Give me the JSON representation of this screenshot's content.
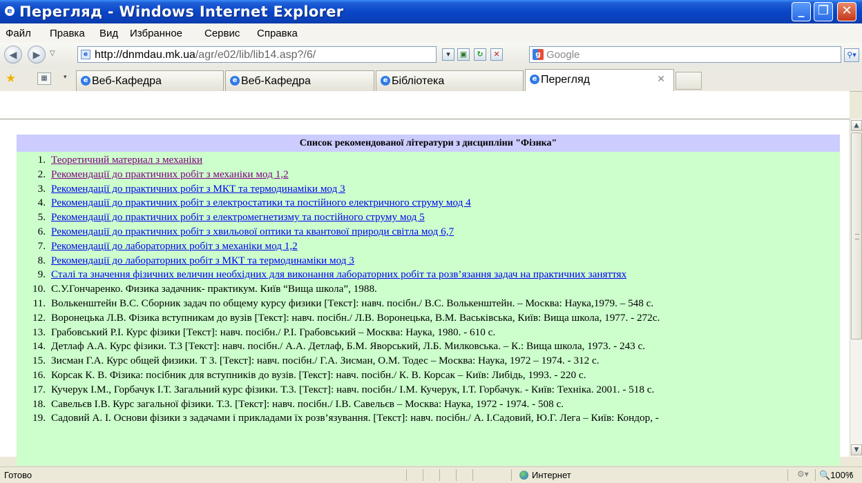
{
  "window": {
    "title": "Перегляд - Windows Internet Explorer",
    "min_glyph": "_",
    "max_glyph": "❐",
    "close_glyph": "✕"
  },
  "menu": {
    "items": [
      "Файл",
      "Правка",
      "Вид",
      "Избранное",
      "Сервис",
      "Справка"
    ]
  },
  "address": {
    "url_host": "http://dnmdau.mk.ua",
    "url_path": "/agr/e02/lib/lib14.asp?/6/",
    "back_glyph": "◀",
    "forward_glyph": "▶",
    "search_placeholder": "Google",
    "search_logo": "g"
  },
  "tabs": [
    {
      "label": "Веб-Кафедра"
    },
    {
      "label": "Веб-Кафедра"
    },
    {
      "label": "Бібліотека"
    },
    {
      "label": "Перегляд",
      "active": true
    }
  ],
  "content": {
    "heading": "Список рекомендованої літератури з дисципліни \"Фізика\"",
    "items": [
      {
        "n": "1.",
        "text": "Теоретичний материал з механіки",
        "link": true,
        "visited": true
      },
      {
        "n": "2.",
        "text": "Рекомендації до практичних робіт з механіки мод 1,2",
        "link": true,
        "visited": true
      },
      {
        "n": "3.",
        "text": "Рекомендації до практичних робіт з МКТ та термодинаміки мод 3",
        "link": true
      },
      {
        "n": "4.",
        "text": "Рекомендації до практичних робіт з електростатики та постійного електричного струму мод 4",
        "link": true
      },
      {
        "n": "5.",
        "text": "Рекомендації до практичних робіт з електромегнетизму та постійного струму мод 5",
        "link": true
      },
      {
        "n": "6.",
        "text": "Рекомендації до практичних робіт з хвильової оптики та квантової природи світла мод 6,7",
        "link": true
      },
      {
        "n": "7.",
        "text": "Рекомендації до лабораторних робіт з механіки мод 1,2",
        "link": true
      },
      {
        "n": "8.",
        "text": "Рекомендації до лабораторних робіт з МКТ та термодинаміки мод 3",
        "link": true
      },
      {
        "n": "9.",
        "text": "Сталі та значення фізичних величин необхідних для виконання лабораторних робіт та розв’язання задач на практичних заняттях",
        "link": true
      },
      {
        "n": "10.",
        "text": "С.У.Гончаренко. Физика задачник- практикум. Київ “Вища школа”, 1988.",
        "link": false
      },
      {
        "n": "11.",
        "text": "Волькенштейн В.С. Сборник задач по общему курсу физики [Текст]: навч. посібн./ В.С. Волькенштейн. – Москва: Наука,1979. – 548 с.",
        "link": false
      },
      {
        "n": "12.",
        "text": "Воронецька Л.В. Фізика вступникам до вузів [Текст]: навч. посібн./ Л.В. Воронецька, В.М. Васьківська, Київ: Вища школа, 1977. - 272с.",
        "link": false
      },
      {
        "n": "13.",
        "text": "Грабовський Р.І. Курс фізики [Текст]: навч. посібн./ Р.І. Грабовський – Москва: Наука, 1980. - 610 с.",
        "link": false
      },
      {
        "n": "14.",
        "text": "Детлаф А.А. Курс фізики. Т.3 [Текст]: навч. посібн./ А.А. Детлаф, Б.М. Яворський, Л.Б. Милковська. – К.: Вища школа, 1973. - 243 с.",
        "link": false
      },
      {
        "n": "15.",
        "text": "Зисман Г.А. Курс общей физики. Т 3. [Текст]: навч. посібн./ Г.А. Зисман, О.М. Тодес – Москва: Наука, 1972 – 1974. - 312 с.",
        "link": false
      },
      {
        "n": "16.",
        "text": "Корсак К. В. Фізика: посібник для вступників до вузів. [Текст]: навч. посібн./ К. В. Корсак – Київ: Либідь, 1993. - 220 с.",
        "link": false
      },
      {
        "n": "17.",
        "text": "Кучерук І.М., Горбачук І.Т. Загальний курс фізики. Т.3. [Текст]: навч. посібн./ І.М. Кучерук, І.Т. Горбачук. - Київ: Техніка. 2001. - 518 с.",
        "link": false
      },
      {
        "n": "18.",
        "text": "Савельєв І.В. Курс загальної фізики. Т.3. [Текст]: навч. посібн./ І.В. Савельєв – Москва: Наука, 1972 - 1974. - 508 с.",
        "link": false
      },
      {
        "n": "19.",
        "text": "Садовий А. І. Основи фізики з задачами і прикладами їх розв’язування. [Текст]: навч. посібн./ А. І.Садовий, Ю.Г. Лега – Київ: Кондор, -",
        "link": false
      }
    ]
  },
  "status": {
    "text": "Готово",
    "zone": "Интернет",
    "zoom": "100%",
    "zoom_icon": "🔍"
  },
  "icons": [
    "ie-logo-icon",
    "back-arrow-icon",
    "forward-arrow-icon",
    "page-icon",
    "compat-view-icon",
    "refresh-icon",
    "stop-icon",
    "google-icon",
    "search-go-icon",
    "favorites-star-icon",
    "quick-tabs-icon",
    "tab-ie-icon",
    "internet-zone-icon",
    "protected-mode-icon",
    "zoom-icon"
  ]
}
